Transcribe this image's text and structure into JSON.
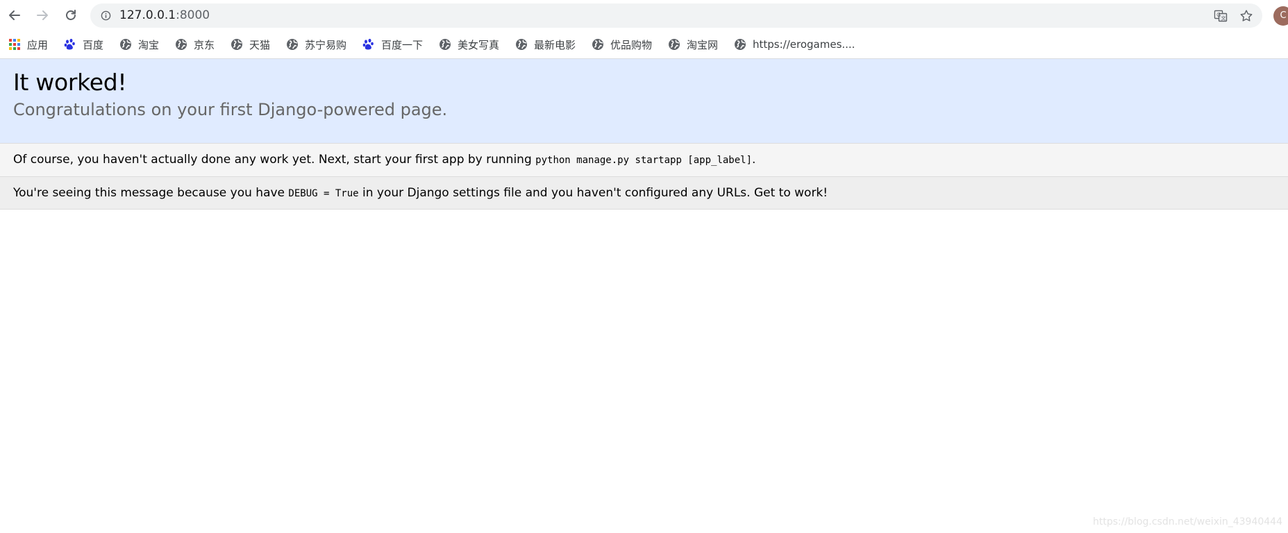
{
  "browser": {
    "url_host": "127.0.0.1",
    "url_port": ":8000",
    "avatar_letter": "C",
    "icons": {
      "back": "back-arrow-icon",
      "forward": "forward-arrow-icon",
      "reload": "reload-icon",
      "info": "info-icon",
      "translate": "translate-icon",
      "bookmark_star": "star-icon"
    }
  },
  "bookmarks": [
    {
      "label": "应用",
      "icon": "apps-grid-icon"
    },
    {
      "label": "百度",
      "icon": "baidu-paw-icon"
    },
    {
      "label": "淘宝",
      "icon": "globe-icon"
    },
    {
      "label": "京东",
      "icon": "globe-icon"
    },
    {
      "label": "天猫",
      "icon": "globe-icon"
    },
    {
      "label": "苏宁易购",
      "icon": "globe-icon"
    },
    {
      "label": "百度一下",
      "icon": "baidu-paw-icon"
    },
    {
      "label": "美女写真",
      "icon": "globe-icon"
    },
    {
      "label": "最新电影",
      "icon": "globe-icon"
    },
    {
      "label": "优品购物",
      "icon": "globe-icon"
    },
    {
      "label": "淘宝网",
      "icon": "globe-icon"
    },
    {
      "label": "https://erogames....",
      "icon": "globe-icon"
    }
  ],
  "page": {
    "title": "It worked!",
    "subtitle": "Congratulations on your first Django-powered page.",
    "instructions": {
      "text_before": "Of course, you haven't actually done any work yet. Next, start your first app by running ",
      "code": "python manage.py startapp [app_label]",
      "text_after": "."
    },
    "explanation": {
      "text_before": "You're seeing this message because you have ",
      "code": "DEBUG = True",
      "text_after": " in your Django settings file and you haven't configured any URLs. Get to work!"
    }
  },
  "watermark": "https://blog.csdn.net/weixin_43940444",
  "colors": {
    "summary_bg": "#e0ebff",
    "instructions_bg": "#f5f5f5",
    "explanation_bg": "#eeeeee",
    "subtitle": "#666666"
  }
}
